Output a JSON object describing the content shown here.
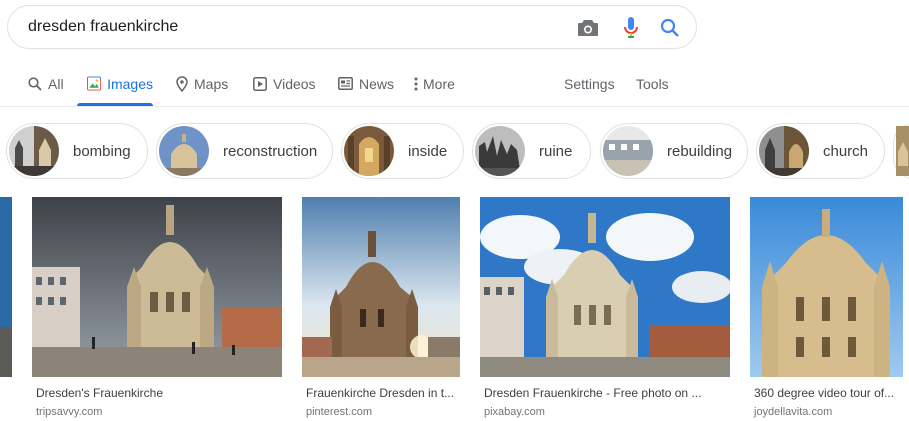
{
  "search": {
    "query": "dresden frauenkirche"
  },
  "icons": {
    "camera": "camera-icon",
    "mic": "microphone-icon",
    "search": "search-icon"
  },
  "colors": {
    "accent": "#1a73e8",
    "tab_inactive": "#5f6368",
    "mic_blue": "#4285f4",
    "mic_red": "#ea4335",
    "mic_yellow": "#fbbc04",
    "mic_green": "#34a853"
  },
  "tabs": [
    {
      "label": "All",
      "icon": "search-icon"
    },
    {
      "label": "Images",
      "icon": "image-icon",
      "active": true
    },
    {
      "label": "Maps",
      "icon": "map-pin-icon"
    },
    {
      "label": "Videos",
      "icon": "play-icon"
    },
    {
      "label": "News",
      "icon": "newspaper-icon"
    },
    {
      "label": "More",
      "icon": "kebab-icon"
    }
  ],
  "tools": {
    "settings": "Settings",
    "tools": "Tools"
  },
  "chips": [
    {
      "label": "bombing"
    },
    {
      "label": "reconstruction"
    },
    {
      "label": "inside"
    },
    {
      "label": "ruine"
    },
    {
      "label": "rebuilding"
    },
    {
      "label": "church"
    }
  ],
  "results": [
    {
      "title": "Dresden's Frauenkirche",
      "source": "tripsavvy.com"
    },
    {
      "title": "Frauenkirche Dresden in t...",
      "source": "pinterest.com"
    },
    {
      "title": "Dresden Frauenkirche - Free photo on ...",
      "source": "pixabay.com"
    },
    {
      "title": "360 degree video tour of...",
      "source": "joydellavita.com"
    }
  ]
}
